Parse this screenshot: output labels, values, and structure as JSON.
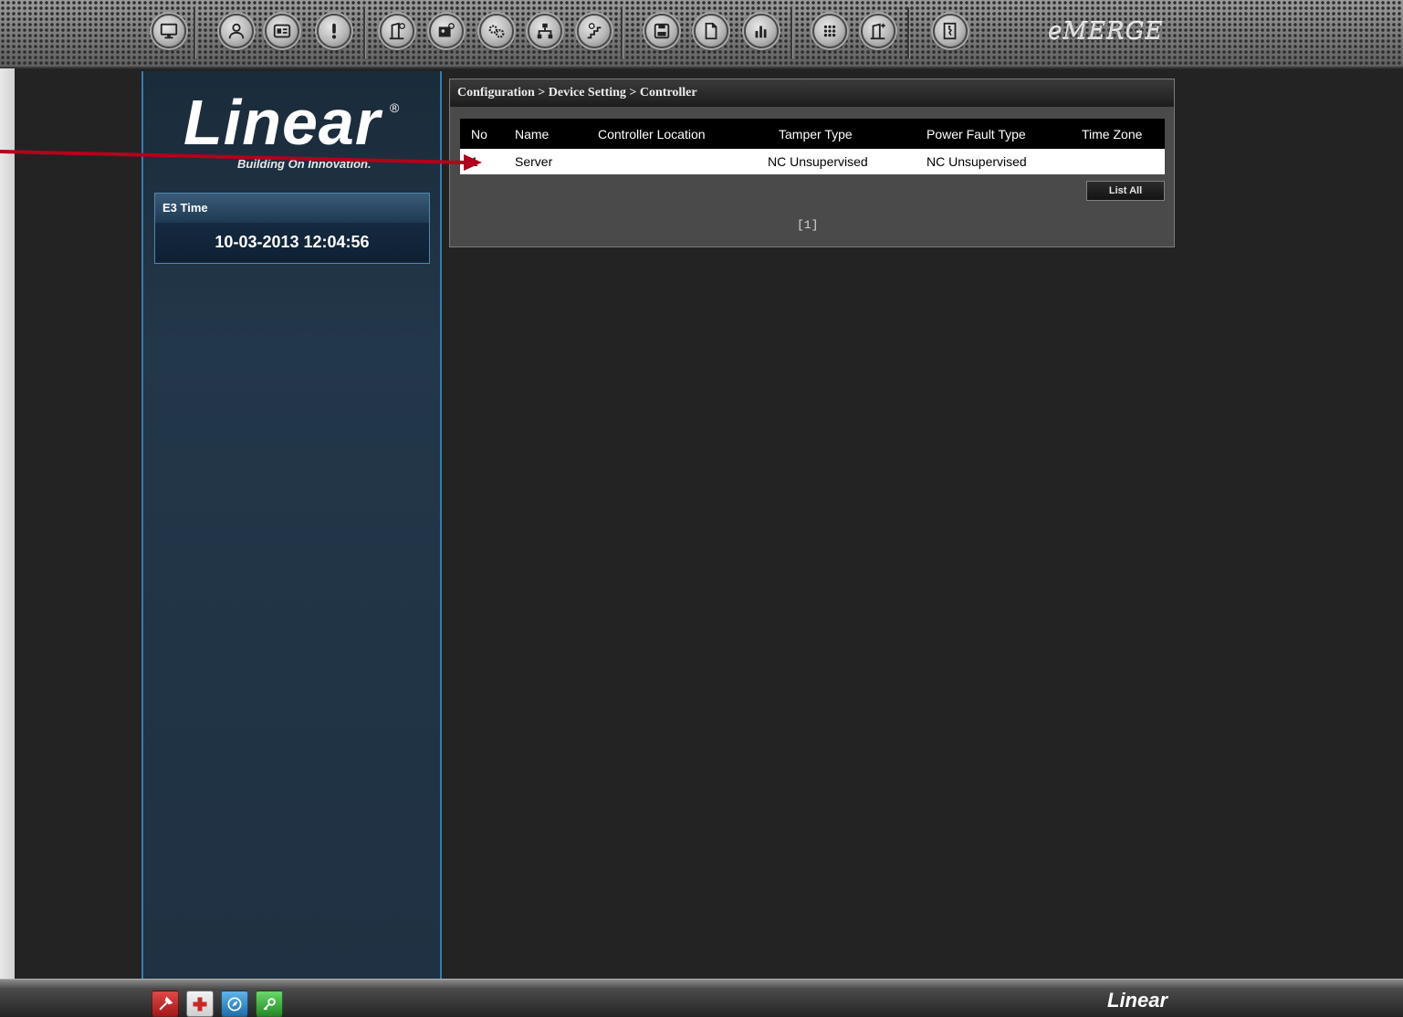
{
  "app": {
    "brand_top_right": "eMERGE",
    "brand_bottom": "Linear"
  },
  "toolbar": {
    "buttons": [
      {
        "icon": "monitor-icon"
      },
      {
        "icon": "person-icon"
      },
      {
        "icon": "id-card-icon"
      },
      {
        "icon": "alert-icon"
      },
      {
        "icon": "door-settings-icon"
      },
      {
        "icon": "photo-settings-icon"
      },
      {
        "icon": "gears-icon"
      },
      {
        "icon": "network-settings-icon"
      },
      {
        "icon": "elevator-settings-icon"
      },
      {
        "icon": "floppy-save-icon"
      },
      {
        "icon": "document-icon"
      },
      {
        "icon": "bar-chart-icon"
      },
      {
        "icon": "keypad-icon"
      },
      {
        "icon": "door-add-icon"
      },
      {
        "icon": "exit-door-icon"
      }
    ]
  },
  "sidebar": {
    "brand_word": "Linear",
    "brand_reg": "®",
    "brand_tagline": "Building On Innovation.",
    "time_panel": {
      "label": "E3 Time",
      "value": "10-03-2013 12:04:56"
    }
  },
  "main": {
    "breadcrumb": "Configuration > Device Setting > Controller",
    "table": {
      "columns": [
        "No",
        "Name",
        "Controller Location",
        "Tamper Type",
        "Power Fault Type",
        "Time Zone"
      ],
      "rows": [
        {
          "no": "1",
          "name": "Server",
          "location": "",
          "tamper_type": "NC Unsupervised",
          "power_fault_type": "NC Unsupervised",
          "time_zone": ""
        }
      ]
    },
    "list_all_label": "List All",
    "pager": "[1]"
  },
  "bottom_bar": {
    "buttons": [
      {
        "icon": "tools-icon",
        "color": "#c62828"
      },
      {
        "icon": "medical-cross-icon",
        "color": "#c62828"
      },
      {
        "icon": "compass-icon",
        "color": "#2a87c9"
      },
      {
        "icon": "key-icon",
        "color": "#3aa83a"
      }
    ]
  },
  "colors": {
    "annotation_arrow": "#b3001b",
    "sidebar_border": "#2f7fb0"
  }
}
